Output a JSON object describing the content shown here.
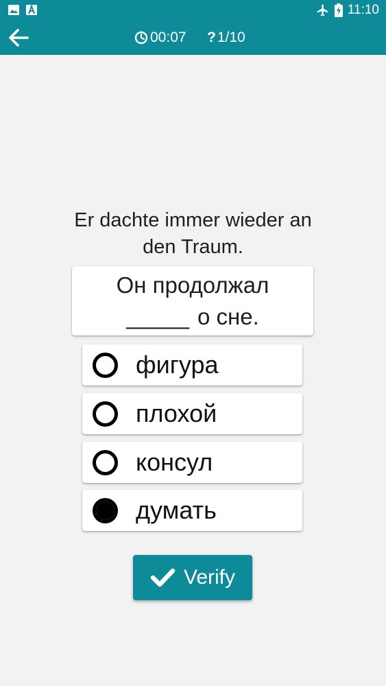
{
  "status_bar": {
    "time": "11:10",
    "left_icons": [
      "image-icon",
      "a-letter-icon"
    ],
    "right_icons": [
      "airplane-icon",
      "battery-icon"
    ]
  },
  "toolbar": {
    "back_icon": "arrow-left-icon",
    "timer_icon": "clock-icon",
    "timer": "00:07",
    "progress_icon": "?",
    "progress": "1/10"
  },
  "question": {
    "source_text": "Er dachte immer wieder an den Traum.",
    "target_line1": "Он продолжал",
    "target_blank": "_____",
    "target_line2_rest": "о сне."
  },
  "options": [
    {
      "label": "фигура",
      "selected": false
    },
    {
      "label": "плохой",
      "selected": false
    },
    {
      "label": "консул",
      "selected": false
    },
    {
      "label": "думать",
      "selected": true
    }
  ],
  "verify_button": {
    "label": "Verify",
    "icon": "checkmark-icon"
  },
  "colors": {
    "accent": "#0e8b98",
    "background": "#f2f2f2"
  }
}
